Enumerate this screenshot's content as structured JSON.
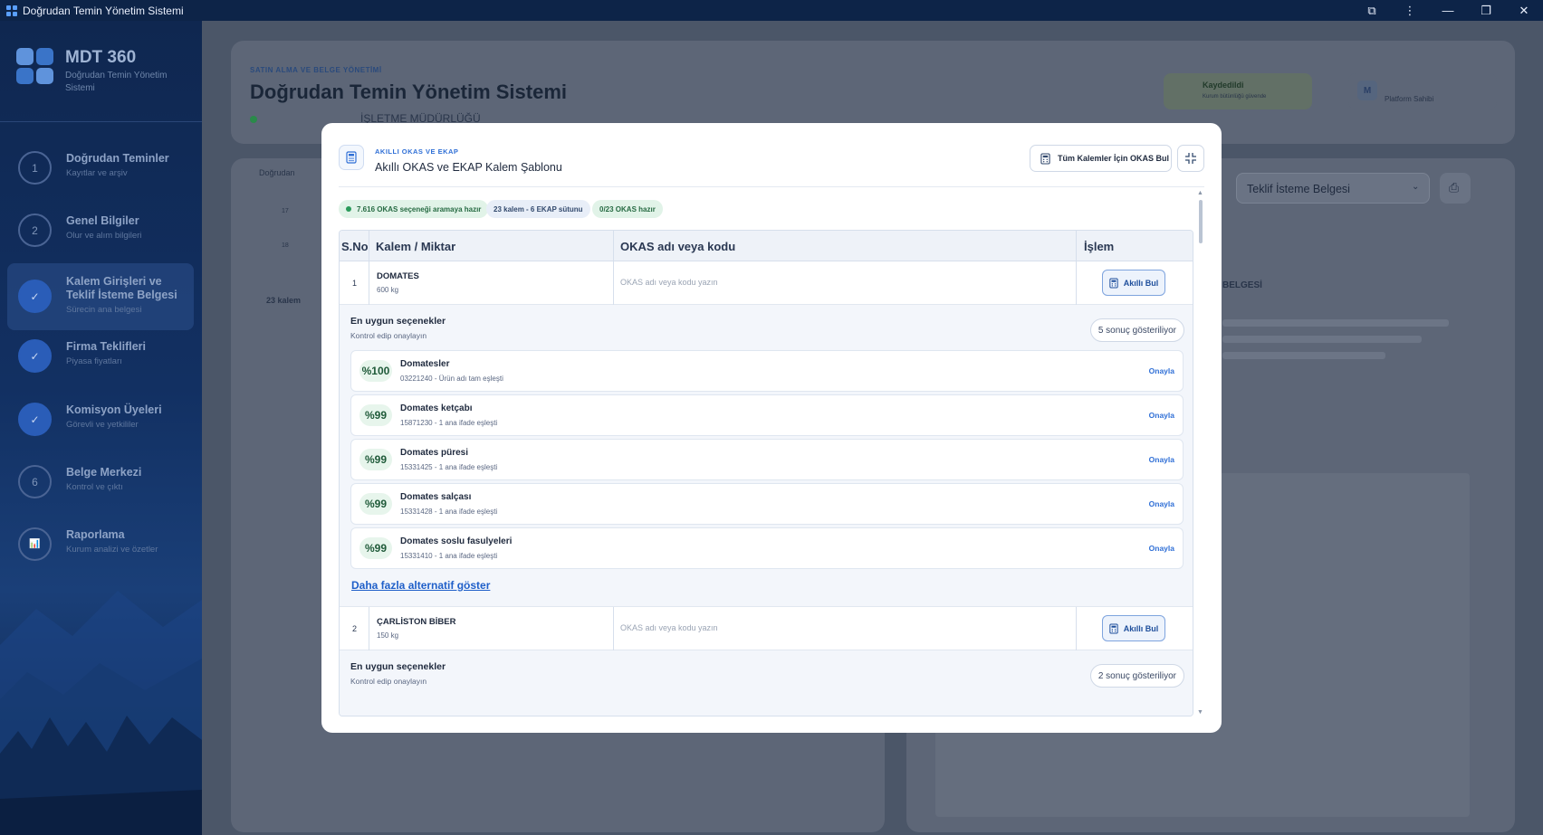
{
  "window": {
    "title": "Doğrudan Temin Yönetim Sistemi",
    "controls": [
      "⧉",
      "⋮",
      "—",
      "❐",
      "✕"
    ]
  },
  "sidebar": {
    "brand_title": "MDT 360",
    "brand_subtitle": "Doğrudan Temin Yönetim Sistemi",
    "items": [
      {
        "badge": "1",
        "title": "Doğrudan Teminler",
        "subtitle": "Kayıtlar ve arşiv",
        "state": "number"
      },
      {
        "badge": "2",
        "title": "Genel Bilgiler",
        "subtitle": "Olur ve alım bilgileri",
        "state": "number"
      },
      {
        "badge": "✓",
        "title": "Kalem Girişleri ve Teklif İsteme Belgesi",
        "subtitle": "Sürecin ana belgesi",
        "state": "active"
      },
      {
        "badge": "✓",
        "title": "Firma Teklifleri",
        "subtitle": "Piyasa fiyatları",
        "state": "done"
      },
      {
        "badge": "✓",
        "title": "Komisyon Üyeleri",
        "subtitle": "Görevli ve yetkililer",
        "state": "done"
      },
      {
        "badge": "6",
        "title": "Belge Merkezi",
        "subtitle": "Kontrol ve çıktı",
        "state": "number"
      },
      {
        "badge": "📊",
        "title": "Raporlama",
        "subtitle": "Kurum analizi ve özetler",
        "state": "icon"
      }
    ]
  },
  "background": {
    "eyebrow": "SATIN ALMA VE BELGE YÖNETİMİ",
    "title": "Doğrudan Temin Yönetim Sistemi",
    "unit": "İŞLETME MÜDÜRLÜĞÜ",
    "saved_title": "Kaydedildi",
    "saved_sub": "Kurum bütünlüğü güvende",
    "user_role": "Platform Sahibi",
    "user_initial": "M",
    "breadcrumb": "Doğrudan",
    "doc_select": "Teklif İsteme Belgesi",
    "row_a": "17",
    "row_b": "18",
    "total": "23 kalem",
    "doc_heading": "BELGESİ"
  },
  "modal": {
    "eyebrow": "AKILLI OKAS VE EKAP",
    "title": "Akıllı OKAS ve EKAP Kalem Şablonu",
    "all_button": "Tüm Kalemler İçin OKAS Bul",
    "pills": {
      "ready": "7.616 OKAS seçeneği aramaya hazır",
      "columns": "23 kalem - 6 EKAP sütunu",
      "okas": "0/23 OKAS hazır"
    },
    "headers": {
      "sno": "S.No",
      "item": "Kalem / Miktar",
      "okas": "OKAS adı veya kodu",
      "action": "İşlem"
    },
    "rows": [
      {
        "sno": "1",
        "name": "DOMATES",
        "qty": "600 kg",
        "okas_placeholder": "OKAS adı veya kodu yazın",
        "button": "Akıllı Bul",
        "suggestions_title": "En uygun seçenekler",
        "suggestions_sub": "Kontrol edip onaylayın",
        "count": "5 sonuç gösteriliyor",
        "options": [
          {
            "score": "%100",
            "name": "Domatesler",
            "code": "03221240 - Ürün adı tam eşleşti",
            "action": "Onayla"
          },
          {
            "score": "%99",
            "name": "Domates ketçabı",
            "code": "15871230 - 1 ana ifade eşleşti",
            "action": "Onayla"
          },
          {
            "score": "%99",
            "name": "Domates püresi",
            "code": "15331425 - 1 ana ifade eşleşti",
            "action": "Onayla"
          },
          {
            "score": "%99",
            "name": "Domates salçası",
            "code": "15331428 - 1 ana ifade eşleşti",
            "action": "Onayla"
          },
          {
            "score": "%99",
            "name": "Domates soslu fasulyeleri",
            "code": "15331410 - 1 ana ifade eşleşti",
            "action": "Onayla"
          }
        ],
        "more": "Daha fazla alternatif göster"
      },
      {
        "sno": "2",
        "name": "ÇARLİSTON BİBER",
        "qty": "150 kg",
        "okas_placeholder": "OKAS adı veya kodu yazın",
        "button": "Akıllı Bul",
        "suggestions_title": "En uygun seçenekler",
        "suggestions_sub": "Kontrol edip onaylayın",
        "count": "2 sonuç gösteriliyor"
      }
    ]
  }
}
